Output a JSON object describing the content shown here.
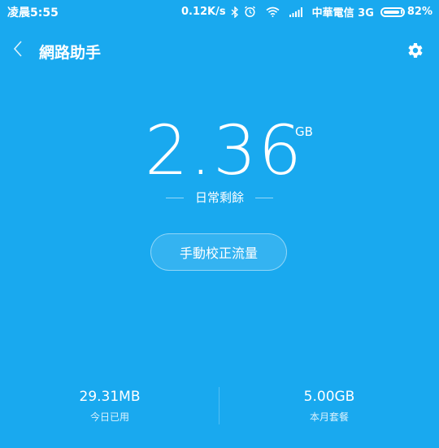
{
  "status_bar": {
    "time": "凌晨5:55",
    "net_speed": "0.12K/s",
    "carrier": "中華電信 3G",
    "battery": "82%",
    "battery_level": 0.82,
    "icons": [
      "bluetooth-icon",
      "alarm-icon",
      "wifi-icon",
      "signal-icon",
      "battery-icon"
    ]
  },
  "header": {
    "title": "網路助手",
    "back_icon": "chevron-left-icon",
    "settings_icon": "gear-icon"
  },
  "main": {
    "value": "2.36",
    "unit": "GB",
    "label": "日常剩餘",
    "calibrate_button": "手動校正流量"
  },
  "stats": {
    "today_used_value": "29.31MB",
    "today_used_label": "今日已用",
    "monthly_plan_value": "5.00GB",
    "monthly_plan_label": "本月套餐"
  },
  "colors": {
    "background": "#19A9EF",
    "foreground": "#FFFFFF"
  }
}
